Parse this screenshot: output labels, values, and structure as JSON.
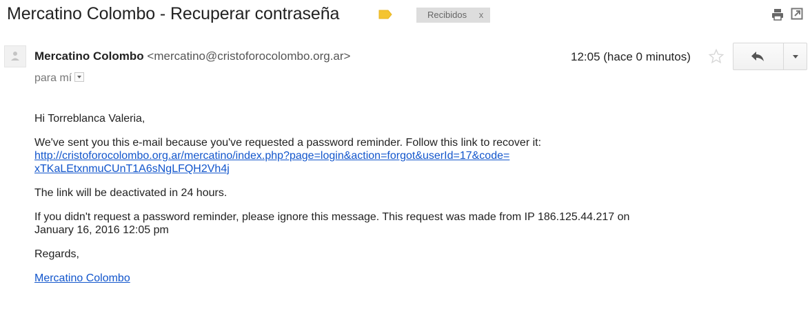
{
  "subject": "Mercatino Colombo - Recuperar contraseña",
  "label_tag_color": "#f4c430",
  "inbox_badge": {
    "label": "Recibidos",
    "remove": "x"
  },
  "icons": {
    "print": "print-icon",
    "new_window": "new-window-icon",
    "star": "star-icon",
    "reply": "reply-icon",
    "more": "chevron-down-icon",
    "avatar": "avatar-icon"
  },
  "message": {
    "sender_name": "Mercatino Colombo",
    "sender_email": "<mercatino@cristoforocolombo.org.ar>",
    "to": "para mí",
    "timestamp": "12:05 (hace 0 minutos)"
  },
  "body": {
    "greeting": "Hi Torreblanca Valeria,",
    "intro": "We've sent you this e-mail because you've requested a password reminder. Follow this link to recover it:",
    "link_line1": "http://cristoforocolombo.org.ar/mercatino/index.php?page=login&action=forgot&userId=17&code=",
    "link_line2": "xTKaLEtxnmuCUnT1A6sNgLFQH2Vh4j",
    "deactivation": "The link will be deactivated in 24 hours.",
    "ignore_line1": "If you didn't request a password reminder, please ignore this message. This request was made from IP 186.125.44.217 on",
    "ignore_line2": "January 16, 2016 12:05 pm",
    "regards": "Regards,",
    "signature": "Mercatino Colombo"
  },
  "colors": {
    "link": "#1155cc",
    "text": "#222222",
    "muted": "#777777"
  }
}
